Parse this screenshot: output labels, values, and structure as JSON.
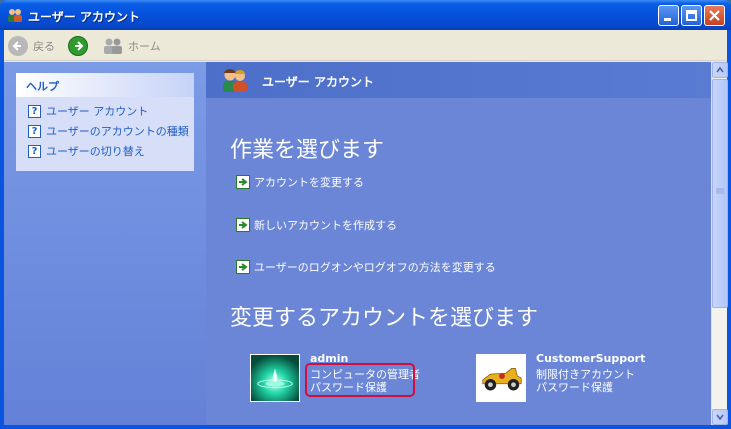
{
  "window": {
    "title": "ユーザー アカウント",
    "controls": {
      "minimize": "minimize",
      "maximize": "maximize",
      "close": "close"
    }
  },
  "toolbar": {
    "back_label": "戻る",
    "home_label": "ホーム"
  },
  "help": {
    "heading": "ヘルプ",
    "items": [
      {
        "label": "ユーザー アカウント",
        "icon": "help-question-icon"
      },
      {
        "label": "ユーザーのアカウントの種類",
        "icon": "help-question-icon"
      },
      {
        "label": "ユーザーの切り替え",
        "icon": "help-question-icon"
      }
    ]
  },
  "main": {
    "header": "ユーザー アカウント",
    "task_heading": "作業を選びます",
    "tasks": [
      {
        "label": "アカウントを変更する",
        "icon": "green-arrow-icon"
      },
      {
        "label": "新しいアカウントを作成する",
        "icon": "green-arrow-icon"
      },
      {
        "label": "ユーザーのログオンやログオフの方法を変更する",
        "icon": "green-arrow-icon"
      }
    ],
    "account_heading": "変更するアカウントを選びます",
    "accounts": [
      {
        "name": "admin",
        "type": "コンピュータの管理者",
        "status": "パスワード保護",
        "picture": "water-drop-picture",
        "highlighted": true
      },
      {
        "name": "CustomerSupport",
        "type": "制限付きアカウント",
        "status": "パスワード保護",
        "picture": "race-car-picture",
        "highlighted": false
      }
    ]
  },
  "colors": {
    "titlebar": "#0550dc",
    "content_bg": "#6b86d6",
    "highlight_border": "#d0103a",
    "link_blue": "#215dc6"
  }
}
